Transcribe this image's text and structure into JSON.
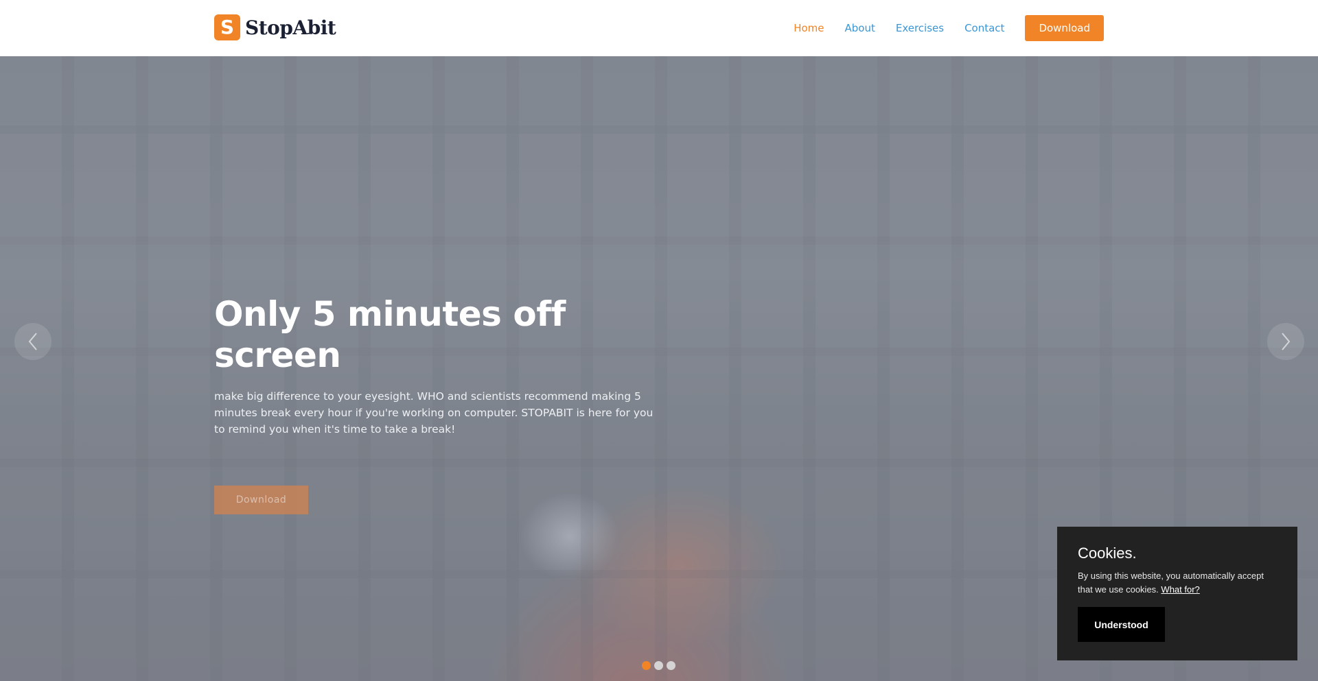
{
  "navbar": {
    "brand": {
      "logo_letter": "S",
      "name": "StopAbit"
    },
    "links": [
      {
        "label": "Home",
        "active": true
      },
      {
        "label": "About",
        "active": false
      },
      {
        "label": "Exercises",
        "active": false
      },
      {
        "label": "Contact",
        "active": false
      }
    ],
    "download_label": "Download"
  },
  "hero": {
    "title": "Only 5 minutes off screen",
    "text": "make big difference to your eyesight. WHO and scientists recommend making 5 minutes break every hour if you're working on computer. STOPABIT is here for you to remind you when it's time to take a break!",
    "button_label": "Download",
    "prev_icon": "chevron-left-icon",
    "next_icon": "chevron-right-icon",
    "slides_total": 3,
    "active_slide": 1
  },
  "cookie_banner": {
    "title": "Cookies.",
    "text": "By using this website, you automatically accept that we use cookies.",
    "link_label": "What for?",
    "button_label": "Understood"
  },
  "colors": {
    "accent": "#f08427",
    "link": "#3a96d4",
    "brand_text": "#1b2033",
    "cookie_bg": "#222222"
  }
}
